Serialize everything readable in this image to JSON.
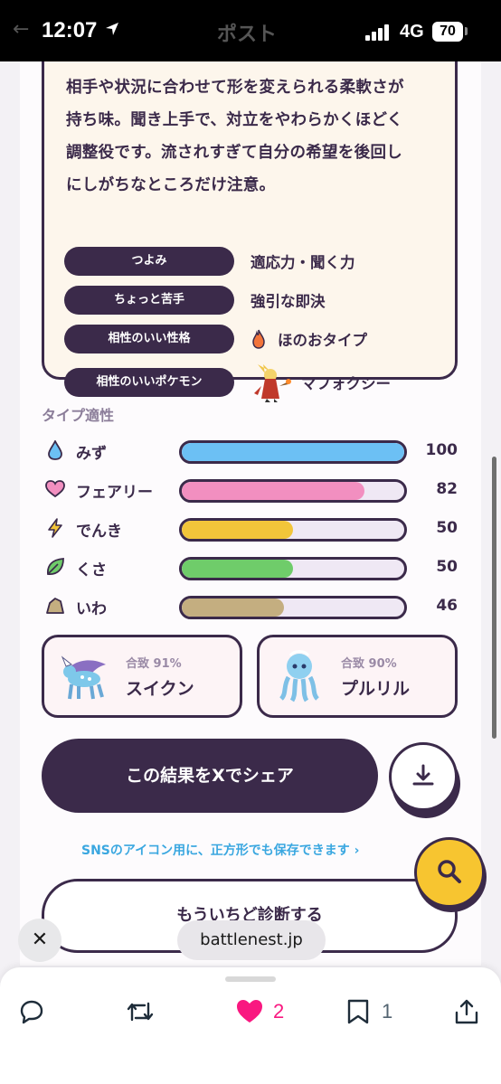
{
  "status_bar": {
    "time": "12:07",
    "network": "4G",
    "battery": "70",
    "back_glyph": "←",
    "ghost_title": "ポスト"
  },
  "card": {
    "description_lines": [
      "相手や状況に合わせて形を変えられる柔軟さが",
      "持ち味。聞き上手で、対立をやわらかくほどく",
      "調整役です。流されすぎて自分の希望を後回し",
      "にしがちなところだけ注意。"
    ],
    "traits": [
      {
        "label": "つよみ",
        "value": "適応力・聞く力",
        "icon": "none"
      },
      {
        "label": "ちょっと苦手",
        "value": "強引な即決",
        "icon": "none"
      },
      {
        "label": "相性のいい性格",
        "value": "ほのおタイプ",
        "icon": "flame-icon"
      },
      {
        "label": "相性のいいポケモン",
        "value": "マフォクシー",
        "icon": "delphox-sprite"
      }
    ]
  },
  "type_section": {
    "title": "タイプ適性",
    "types": [
      {
        "name": "みず",
        "value": 100,
        "color": "#6cc0f4",
        "icon": "water-drop-icon"
      },
      {
        "name": "フェアリー",
        "value": 82,
        "color": "#f28fc0",
        "icon": "heart-icon"
      },
      {
        "name": "でんき",
        "value": 50,
        "color": "#f2c53a",
        "icon": "lightning-icon"
      },
      {
        "name": "くさ",
        "value": 50,
        "color": "#6fcc6a",
        "icon": "leaf-icon"
      },
      {
        "name": "いわ",
        "value": 46,
        "color": "#c4ae80",
        "icon": "rock-icon"
      }
    ]
  },
  "matches": [
    {
      "pct": "合致 91%",
      "name": "スイクン",
      "sprite": "suicune-sprite"
    },
    {
      "pct": "合致 90%",
      "name": "プルリル",
      "sprite": "frillish-sprite"
    }
  ],
  "actions": {
    "share_label": "この結果をXでシェア",
    "download_icon": "download-icon",
    "sns_link": "SNSのアイコン用に、正方形でも保存できます ›",
    "retry_label": "もういちど診断する",
    "search_icon": "search-icon"
  },
  "browser": {
    "close_glyph": "✕",
    "url": "battlenest.jp"
  },
  "tweet_actions": {
    "likes": "2",
    "bookmarks": "1",
    "like_color": "#f91880"
  }
}
